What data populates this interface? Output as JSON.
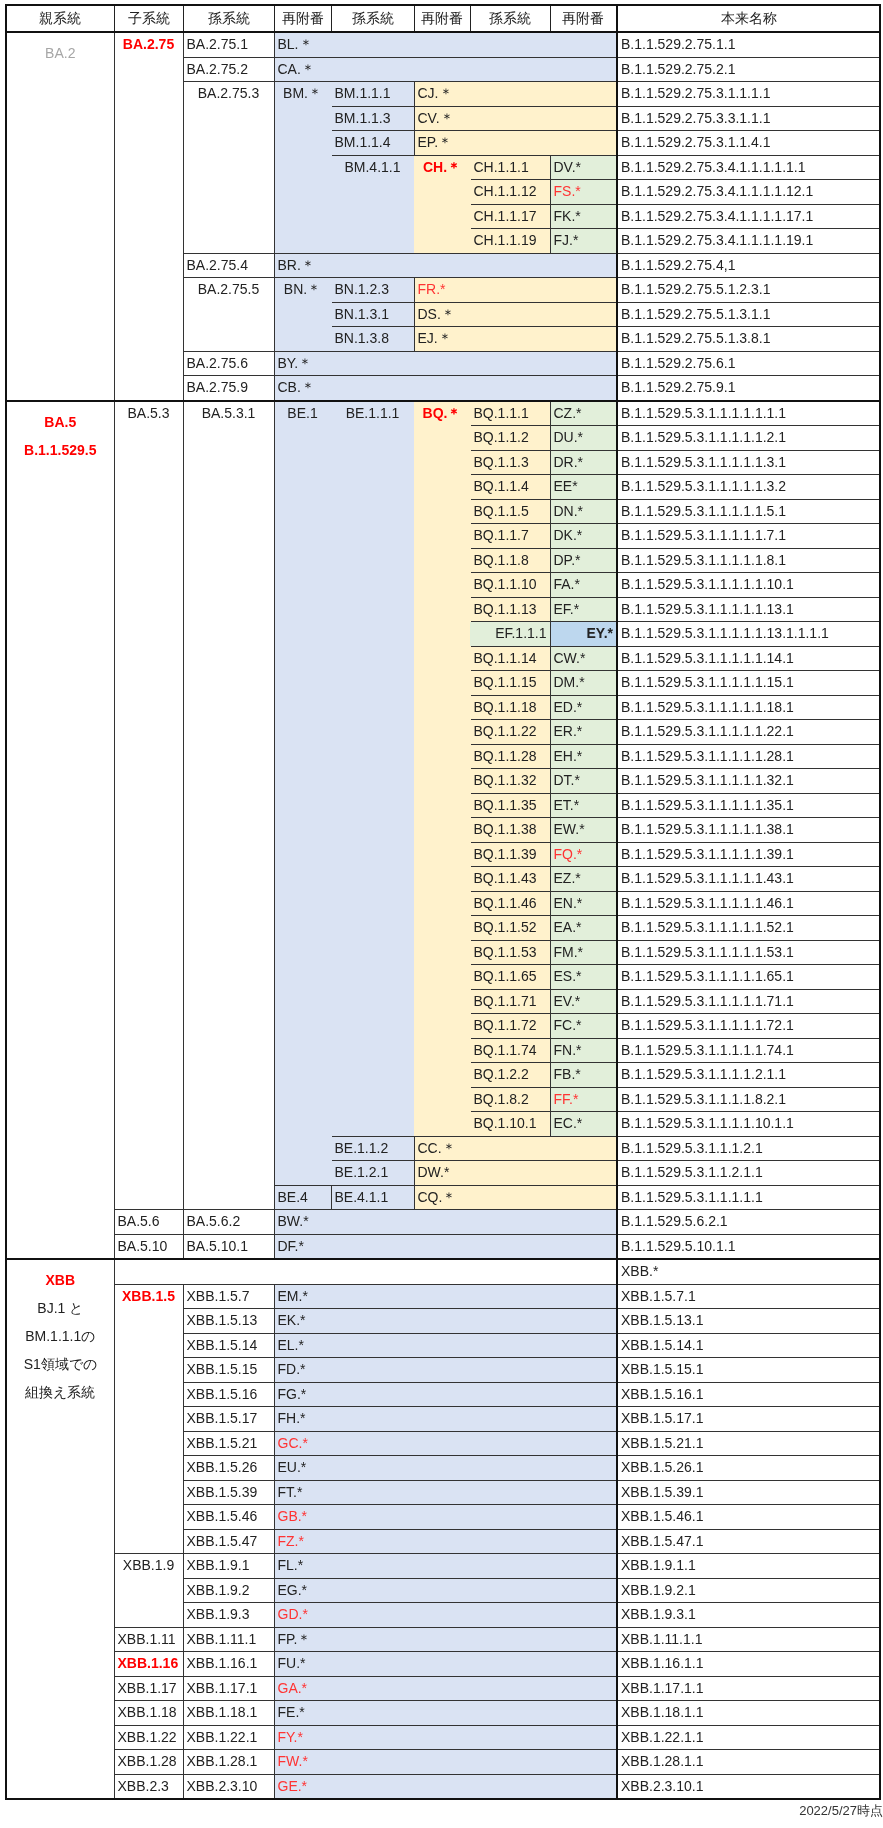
{
  "table": {
    "columns": [
      "親系統",
      "子系統",
      "孫系統",
      "再附番",
      "孫系統",
      "再附番",
      "孫系統",
      "再附番",
      "本来名称"
    ],
    "sections": [
      {
        "rows": [
          {
            "cells": [
              {
                "lines": [
                  {
                    "text": "BA.2",
                    "color": "#a6a6a6"
                  }
                ],
                "rowspan": 15
              },
              {
                "text": "BA.2.75",
                "color": "#ff0000",
                "bold": true,
                "rowspan": 15
              },
              {
                "text": "BA.2.75.1"
              },
              {
                "text": "BL.＊",
                "colspan": 5,
                "kind": "blue"
              },
              {
                "text": "B.1.1.529.2.75.1.1"
              }
            ]
          },
          {
            "cells": [
              {
                "text": "BA.2.75.2"
              },
              {
                "text": "CA.＊",
                "colspan": 5,
                "kind": "blue"
              },
              {
                "text": "B.1.1.529.2.75.2.1"
              }
            ]
          },
          {
            "cells": [
              {
                "text": "BA.2.75.3",
                "rowspan": 7
              },
              {
                "text": "BM.＊",
                "rowspan": 7,
                "kind": "blue"
              },
              {
                "text": "BM.1.1.1",
                "kind": "blue"
              },
              {
                "text": "CJ.＊",
                "colspan": 3,
                "kind": "yellow"
              },
              {
                "text": "B.1.1.529.2.75.3.1.1.1.1"
              }
            ]
          },
          {
            "cells": [
              {
                "text": "BM.1.1.3",
                "kind": "blue"
              },
              {
                "text": "CV.＊",
                "colspan": 3,
                "kind": "yellow"
              },
              {
                "text": "B.1.1.529.2.75.3.3.1.1.1"
              }
            ]
          },
          {
            "cells": [
              {
                "text": "BM.1.1.4",
                "kind": "blue"
              },
              {
                "text": "EP.＊",
                "colspan": 3,
                "kind": "yellow"
              },
              {
                "text": "B.1.1.529.2.75.3.1.1.4.1"
              }
            ]
          },
          {
            "cells": [
              {
                "text": "BM.4.1.1",
                "rowspan": 4,
                "kind": "blue"
              },
              {
                "text": "CH.＊",
                "rowspan": 4,
                "kind": "yellow",
                "color": "#ff0000",
                "bold": true
              },
              {
                "text": "CH.1.1.1",
                "kind": "yellow"
              },
              {
                "text": "DV.*",
                "kind": "green"
              },
              {
                "text": "B.1.1.529.2.75.3.4.1.1.1.1.1.1"
              }
            ]
          },
          {
            "cells": [
              {
                "text": "CH.1.1.12",
                "kind": "yellow"
              },
              {
                "text": "FS.*",
                "kind": "green",
                "color": "#ff3333"
              },
              {
                "text": "B.1.1.529.2.75.3.4.1.1.1.1.12.1"
              }
            ]
          },
          {
            "cells": [
              {
                "text": "CH.1.1.17",
                "kind": "yellow"
              },
              {
                "text": "FK.*",
                "kind": "green"
              },
              {
                "text": "B.1.1.529.2.75.3.4.1.1.1.1.17.1"
              }
            ]
          },
          {
            "cells": [
              {
                "text": "CH.1.1.19",
                "kind": "yellow"
              },
              {
                "text": "FJ.*",
                "kind": "green"
              },
              {
                "text": "B.1.1.529.2.75.3.4.1.1.1.1.19.1"
              }
            ]
          },
          {
            "cells": [
              {
                "text": "BA.2.75.4"
              },
              {
                "text": "BR.＊",
                "colspan": 5,
                "kind": "blue"
              },
              {
                "text": "B.1.1.529.2.75.4,1"
              }
            ]
          },
          {
            "cells": [
              {
                "text": "BA.2.75.5",
                "rowspan": 3
              },
              {
                "text": "BN.＊",
                "rowspan": 3,
                "kind": "blue"
              },
              {
                "text": "BN.1.2.3",
                "kind": "blue"
              },
              {
                "text": "FR.*",
                "colspan": 3,
                "kind": "yellow",
                "color": "#ff3333"
              },
              {
                "text": "B.1.1.529.2.75.5.1.2.3.1"
              }
            ]
          },
          {
            "cells": [
              {
                "text": "BN.1.3.1",
                "kind": "blue"
              },
              {
                "text": "DS.＊",
                "colspan": 3,
                "kind": "yellow"
              },
              {
                "text": "B.1.1.529.2.75.5.1.3.1.1"
              }
            ]
          },
          {
            "cells": [
              {
                "text": "BN.1.3.8",
                "kind": "blue"
              },
              {
                "text": "EJ.＊",
                "colspan": 3,
                "kind": "yellow"
              },
              {
                "text": "B.1.1.529.2.75.5.1.3.8.1"
              }
            ]
          },
          {
            "cells": [
              {
                "text": "BA.2.75.6"
              },
              {
                "text": "BY.＊",
                "colspan": 5,
                "kind": "blue"
              },
              {
                "text": "B.1.1.529.2.75.6.1"
              }
            ]
          },
          {
            "cells": [
              {
                "text": "BA.2.75.9"
              },
              {
                "text": "CB.＊",
                "colspan": 5,
                "kind": "blue"
              },
              {
                "text": "B.1.1.529.2.75.9.1"
              }
            ]
          }
        ]
      },
      {
        "rows": [
          {
            "cells": [
              {
                "lines": [
                  {
                    "text": "BA.5",
                    "color": "#ff0000",
                    "bold": true
                  },
                  {
                    "text": "B.1.1.529.5",
                    "color": "#ff0000",
                    "bold": true
                  }
                ],
                "rowspan": 35
              },
              {
                "text": "BA.5.3",
                "rowspan": 33
              },
              {
                "text": "BA.5.3.1",
                "rowspan": 33
              },
              {
                "text": "BE.1",
                "rowspan": 32,
                "kind": "blue"
              },
              {
                "text": "BE.1.1.1",
                "rowspan": 30,
                "kind": "blue"
              },
              {
                "text": "BQ.＊",
                "rowspan": 30,
                "kind": "yellow",
                "color": "#ff0000",
                "bold": true
              },
              {
                "text": "BQ.1.1.1",
                "kind": "yellow"
              },
              {
                "text": "CZ.*",
                "kind": "green"
              },
              {
                "text": "B.1.1.529.5.3.1.1.1.1.1.1.1"
              }
            ]
          },
          {
            "cells": [
              {
                "text": "BQ.1.1.2",
                "kind": "yellow"
              },
              {
                "text": "DU.*",
                "kind": "green"
              },
              {
                "text": "B.1.1.529.5.3.1.1.1.1.1.2.1"
              }
            ]
          },
          {
            "cells": [
              {
                "text": "BQ.1.1.3",
                "kind": "yellow"
              },
              {
                "text": "DR.*",
                "kind": "green"
              },
              {
                "text": "B.1.1.529.5.3.1.1.1.1.1.3.1"
              }
            ]
          },
          {
            "cells": [
              {
                "text": "BQ.1.1.4",
                "kind": "yellow"
              },
              {
                "text": "EE*",
                "kind": "green"
              },
              {
                "text": "B.1.1.529.5.3.1.1.1.1.1.3.2"
              }
            ]
          },
          {
            "cells": [
              {
                "text": "BQ.1.1.5",
                "kind": "yellow"
              },
              {
                "text": "DN.*",
                "kind": "green"
              },
              {
                "text": "B.1.1.529.5.3.1.1.1.1.1.5.1"
              }
            ]
          },
          {
            "cells": [
              {
                "text": "BQ.1.1.7",
                "kind": "yellow"
              },
              {
                "text": "DK.*",
                "kind": "green"
              },
              {
                "text": "B.1.1.529.5.3.1.1.1.1.1.7.1"
              }
            ]
          },
          {
            "cells": [
              {
                "text": "BQ.1.1.8",
                "kind": "yellow"
              },
              {
                "text": "DP.*",
                "kind": "green"
              },
              {
                "text": "B.1.1.529.5.3.1.1.1.1.1.8.1"
              }
            ]
          },
          {
            "cells": [
              {
                "text": "BQ.1.1.10",
                "kind": "yellow"
              },
              {
                "text": "FA.*",
                "kind": "green"
              },
              {
                "text": "B.1.1.529.5.3.1.1.1.1.1.10.1"
              }
            ]
          },
          {
            "cells": [
              {
                "text": "BQ.1.1.13",
                "kind": "yellow"
              },
              {
                "text": "EF.*",
                "kind": "green"
              },
              {
                "text": "B.1.1.529.5.3.1.1.1.1.1.13.1"
              }
            ]
          },
          {
            "cells": [
              {
                "text": "EF.1.1.1",
                "kind": "green"
              },
              {
                "text": "EY.*",
                "kind": "lightblue",
                "bold": true
              },
              {
                "text": "B.1.1.529.5.3.1.1.1.1.1.13.1.1.1.1"
              }
            ]
          },
          {
            "cells": [
              {
                "text": "BQ.1.1.14",
                "kind": "yellow"
              },
              {
                "text": "CW.*",
                "kind": "green"
              },
              {
                "text": "B.1.1.529.5.3.1.1.1.1.1.14.1"
              }
            ]
          },
          {
            "cells": [
              {
                "text": "BQ.1.1.15",
                "kind": "yellow"
              },
              {
                "text": "DM.*",
                "kind": "green"
              },
              {
                "text": "B.1.1.529.5.3.1.1.1.1.1.15.1"
              }
            ]
          },
          {
            "cells": [
              {
                "text": "BQ.1.1.18",
                "kind": "yellow"
              },
              {
                "text": "ED.*",
                "kind": "green"
              },
              {
                "text": "B.1.1.529.5.3.1.1.1.1.1.18.1"
              }
            ]
          },
          {
            "cells": [
              {
                "text": "BQ.1.1.22",
                "kind": "yellow"
              },
              {
                "text": "ER.*",
                "kind": "green"
              },
              {
                "text": "B.1.1.529.5.3.1.1.1.1.1.22.1"
              }
            ]
          },
          {
            "cells": [
              {
                "text": "BQ.1.1.28",
                "kind": "yellow"
              },
              {
                "text": "EH.*",
                "kind": "green"
              },
              {
                "text": "B.1.1.529.5.3.1.1.1.1.1.28.1"
              }
            ]
          },
          {
            "cells": [
              {
                "text": "BQ.1.1.32",
                "kind": "yellow"
              },
              {
                "text": "DT.*",
                "kind": "green"
              },
              {
                "text": "B.1.1.529.5.3.1.1.1.1.1.32.1"
              }
            ]
          },
          {
            "cells": [
              {
                "text": "BQ.1.1.35",
                "kind": "yellow"
              },
              {
                "text": "ET.*",
                "kind": "green"
              },
              {
                "text": "B.1.1.529.5.3.1.1.1.1.1.35.1"
              }
            ]
          },
          {
            "cells": [
              {
                "text": "BQ.1.1.38",
                "kind": "yellow"
              },
              {
                "text": "EW.*",
                "kind": "green"
              },
              {
                "text": "B.1.1.529.5.3.1.1.1.1.1.38.1"
              }
            ]
          },
          {
            "cells": [
              {
                "text": "BQ.1.1.39",
                "kind": "yellow"
              },
              {
                "text": "FQ.*",
                "kind": "green",
                "color": "#ff3333"
              },
              {
                "text": "B.1.1.529.5.3.1.1.1.1.1.39.1"
              }
            ]
          },
          {
            "cells": [
              {
                "text": "BQ.1.1.43",
                "kind": "yellow"
              },
              {
                "text": "EZ.*",
                "kind": "green"
              },
              {
                "text": "B.1.1.529.5.3.1.1.1.1.1.43.1"
              }
            ]
          },
          {
            "cells": [
              {
                "text": "BQ.1.1.46",
                "kind": "yellow"
              },
              {
                "text": "EN.*",
                "kind": "green"
              },
              {
                "text": "B.1.1.529.5.3.1.1.1.1.1.46.1"
              }
            ]
          },
          {
            "cells": [
              {
                "text": "BQ.1.1.52",
                "kind": "yellow"
              },
              {
                "text": "EA.*",
                "kind": "green"
              },
              {
                "text": "B.1.1.529.5.3.1.1.1.1.1.52.1"
              }
            ]
          },
          {
            "cells": [
              {
                "text": "BQ.1.1.53",
                "kind": "yellow"
              },
              {
                "text": "FM.*",
                "kind": "green"
              },
              {
                "text": "B.1.1.529.5.3.1.1.1.1.1.53.1"
              }
            ]
          },
          {
            "cells": [
              {
                "text": "BQ.1.1.65",
                "kind": "yellow"
              },
              {
                "text": "ES.*",
                "kind": "green"
              },
              {
                "text": "B.1.1.529.5.3.1.1.1.1.1.65.1"
              }
            ]
          },
          {
            "cells": [
              {
                "text": "BQ.1.1.71",
                "kind": "yellow"
              },
              {
                "text": "EV.*",
                "kind": "green"
              },
              {
                "text": "B.1.1.529.5.3.1.1.1.1.1.71.1"
              }
            ]
          },
          {
            "cells": [
              {
                "text": "BQ.1.1.72",
                "kind": "yellow"
              },
              {
                "text": "FC.*",
                "kind": "green"
              },
              {
                "text": "B.1.1.529.5.3.1.1.1.1.1.72.1"
              }
            ]
          },
          {
            "cells": [
              {
                "text": "BQ.1.1.74",
                "kind": "yellow"
              },
              {
                "text": "FN.*",
                "kind": "green"
              },
              {
                "text": "B.1.1.529.5.3.1.1.1.1.1.74.1"
              }
            ]
          },
          {
            "cells": [
              {
                "text": "BQ.1.2.2",
                "kind": "yellow"
              },
              {
                "text": "FB.*",
                "kind": "green"
              },
              {
                "text": "B.1.1.529.5.3.1.1.1.1.2.1.1"
              }
            ]
          },
          {
            "cells": [
              {
                "text": "BQ.1.8.2",
                "kind": "yellow"
              },
              {
                "text": "FF.*",
                "kind": "green",
                "color": "#ff3333"
              },
              {
                "text": "B.1.1.529.5.3.1.1.1.1.8.2.1"
              }
            ]
          },
          {
            "cells": [
              {
                "text": "BQ.1.10.1",
                "kind": "yellow"
              },
              {
                "text": "EC.*",
                "kind": "green"
              },
              {
                "text": "B.1.1.529.5.3.1.1.1.1.10.1.1"
              }
            ]
          },
          {
            "cells": [
              {
                "text": "BE.1.1.2",
                "kind": "blue"
              },
              {
                "text": "CC.＊",
                "colspan": 3,
                "kind": "yellow"
              },
              {
                "text": "B.1.1.529.5.3.1.1.1.2.1"
              }
            ]
          },
          {
            "cells": [
              {
                "text": "BE.1.2.1",
                "kind": "blue"
              },
              {
                "text": "DW.*",
                "colspan": 3,
                "kind": "yellow"
              },
              {
                "text": "B.1.1.529.5.3.1.1.2.1.1"
              }
            ]
          },
          {
            "cells": [
              {
                "text": "BE.4",
                "kind": "blue"
              },
              {
                "text": "BE.4.1.1",
                "kind": "blue"
              },
              {
                "text": "CQ.＊",
                "colspan": 3,
                "kind": "yellow"
              },
              {
                "text": "B.1.1.529.5.3.1.1.1.1.1"
              }
            ]
          },
          {
            "cells": [
              {
                "text": "BA.5.6"
              },
              {
                "text": "BA.5.6.2"
              },
              {
                "text": "BW.*",
                "colspan": 5,
                "kind": "blue"
              },
              {
                "text": "B.1.1.529.5.6.2.1"
              }
            ]
          },
          {
            "cells": [
              {
                "text": "BA.5.10"
              },
              {
                "text": "BA.5.10.1"
              },
              {
                "text": "DF.*",
                "colspan": 5,
                "kind": "blue"
              },
              {
                "text": "B.1.1.529.5.10.1.1"
              }
            ]
          }
        ]
      },
      {
        "rows": [
          {
            "cells": [
              {
                "lines": [
                  {
                    "text": "XBB",
                    "color": "#ff0000",
                    "bold": true
                  },
                  {
                    "text": "BJ.1 と"
                  },
                  {
                    "text": "BM.1.1.1の"
                  },
                  {
                    "text": "S1領域での"
                  },
                  {
                    "text": "組換え系統"
                  }
                ],
                "rowspan": 22
              },
              {
                "colspan": 7,
                "kind": "blank"
              },
              {
                "text": "XBB.*"
              }
            ]
          },
          {
            "cells": [
              {
                "text": "XBB.1.5",
                "color": "#ff0000",
                "bold": true,
                "rowspan": 11
              },
              {
                "text": "XBB.1.5.7"
              },
              {
                "text": "EM.*",
                "colspan": 5,
                "kind": "blue"
              },
              {
                "text": "XBB.1.5.7.1"
              }
            ]
          },
          {
            "cells": [
              {
                "text": "XBB.1.5.13"
              },
              {
                "text": "EK.*",
                "colspan": 5,
                "kind": "blue"
              },
              {
                "text": "XBB.1.5.13.1"
              }
            ]
          },
          {
            "cells": [
              {
                "text": "XBB.1.5.14"
              },
              {
                "text": "EL.*",
                "colspan": 5,
                "kind": "blue"
              },
              {
                "text": "XBB.1.5.14.1"
              }
            ]
          },
          {
            "cells": [
              {
                "text": "XBB.1.5.15"
              },
              {
                "text": "FD.*",
                "colspan": 5,
                "kind": "blue"
              },
              {
                "text": "XBB.1.5.15.1"
              }
            ]
          },
          {
            "cells": [
              {
                "text": "XBB.1.5.16"
              },
              {
                "text": "FG.*",
                "colspan": 5,
                "kind": "blue"
              },
              {
                "text": "XBB.1.5.16.1"
              }
            ]
          },
          {
            "cells": [
              {
                "text": "XBB.1.5.17"
              },
              {
                "text": "FH.*",
                "colspan": 5,
                "kind": "blue"
              },
              {
                "text": "XBB.1.5.17.1"
              }
            ]
          },
          {
            "cells": [
              {
                "text": "XBB.1.5.21"
              },
              {
                "text": "GC.*",
                "colspan": 5,
                "kind": "blue",
                "color": "#ff3333"
              },
              {
                "text": "XBB.1.5.21.1"
              }
            ]
          },
          {
            "cells": [
              {
                "text": "XBB.1.5.26"
              },
              {
                "text": "EU.*",
                "colspan": 5,
                "kind": "blue"
              },
              {
                "text": "XBB.1.5.26.1"
              }
            ]
          },
          {
            "cells": [
              {
                "text": "XBB.1.5.39"
              },
              {
                "text": "FT.*",
                "colspan": 5,
                "kind": "blue"
              },
              {
                "text": "XBB.1.5.39.1"
              }
            ]
          },
          {
            "cells": [
              {
                "text": "XBB.1.5.46"
              },
              {
                "text": "GB.*",
                "colspan": 5,
                "kind": "blue",
                "color": "#ff3333"
              },
              {
                "text": "XBB.1.5.46.1"
              }
            ]
          },
          {
            "cells": [
              {
                "text": "XBB.1.5.47"
              },
              {
                "text": "FZ.*",
                "colspan": 5,
                "kind": "blue",
                "color": "#ff3333"
              },
              {
                "text": "XBB.1.5.47.1"
              }
            ]
          },
          {
            "cells": [
              {
                "text": "XBB.1.9",
                "rowspan": 3
              },
              {
                "text": "XBB.1.9.1"
              },
              {
                "text": "FL.*",
                "colspan": 5,
                "kind": "blue"
              },
              {
                "text": "XBB.1.9.1.1"
              }
            ]
          },
          {
            "cells": [
              {
                "text": "XBB.1.9.2"
              },
              {
                "text": "EG.*",
                "colspan": 5,
                "kind": "blue"
              },
              {
                "text": "XBB.1.9.2.1"
              }
            ]
          },
          {
            "cells": [
              {
                "text": "XBB.1.9.3"
              },
              {
                "text": "GD.*",
                "colspan": 5,
                "kind": "blue",
                "color": "#ff3333"
              },
              {
                "text": "XBB.1.9.3.1"
              }
            ]
          },
          {
            "cells": [
              {
                "text": "XBB.1.11"
              },
              {
                "text": "XBB.1.11.1"
              },
              {
                "text": "FP.＊",
                "colspan": 5,
                "kind": "blue"
              },
              {
                "text": "XBB.1.11.1.1"
              }
            ]
          },
          {
            "cells": [
              {
                "text": "XBB.1.16",
                "color": "#ff0000",
                "bold": true
              },
              {
                "text": "XBB.1.16.1"
              },
              {
                "text": "FU.*",
                "colspan": 5,
                "kind": "blue"
              },
              {
                "text": "XBB.1.16.1.1"
              }
            ]
          },
          {
            "cells": [
              {
                "text": "XBB.1.17"
              },
              {
                "text": "XBB.1.17.1"
              },
              {
                "text": "GA.*",
                "colspan": 5,
                "kind": "blue",
                "color": "#ff3333"
              },
              {
                "text": "XBB.1.17.1.1"
              }
            ]
          },
          {
            "cells": [
              {
                "text": "XBB.1.18"
              },
              {
                "text": "XBB.1.18.1"
              },
              {
                "text": "FE.*",
                "colspan": 5,
                "kind": "blue"
              },
              {
                "text": "XBB.1.18.1.1"
              }
            ]
          },
          {
            "cells": [
              {
                "text": "XBB.1.22"
              },
              {
                "text": "XBB.1.22.1"
              },
              {
                "text": "FY.*",
                "colspan": 5,
                "kind": "blue",
                "color": "#ff3333"
              },
              {
                "text": "XBB.1.22.1.1"
              }
            ]
          },
          {
            "cells": [
              {
                "text": "XBB.1.28"
              },
              {
                "text": "XBB.1.28.1"
              },
              {
                "text": "FW.*",
                "colspan": 5,
                "kind": "blue",
                "color": "#ff3333"
              },
              {
                "text": "XBB.1.28.1.1"
              }
            ]
          },
          {
            "cells": [
              {
                "text": "XBB.2.3"
              },
              {
                "text": "XBB.2.3.10"
              },
              {
                "text": "GE.*",
                "colspan": 5,
                "kind": "blue",
                "color": "#ff3333"
              },
              {
                "text": "XBB.2.3.10.1"
              }
            ]
          }
        ]
      }
    ]
  },
  "footnote": "2022/5/27時点"
}
